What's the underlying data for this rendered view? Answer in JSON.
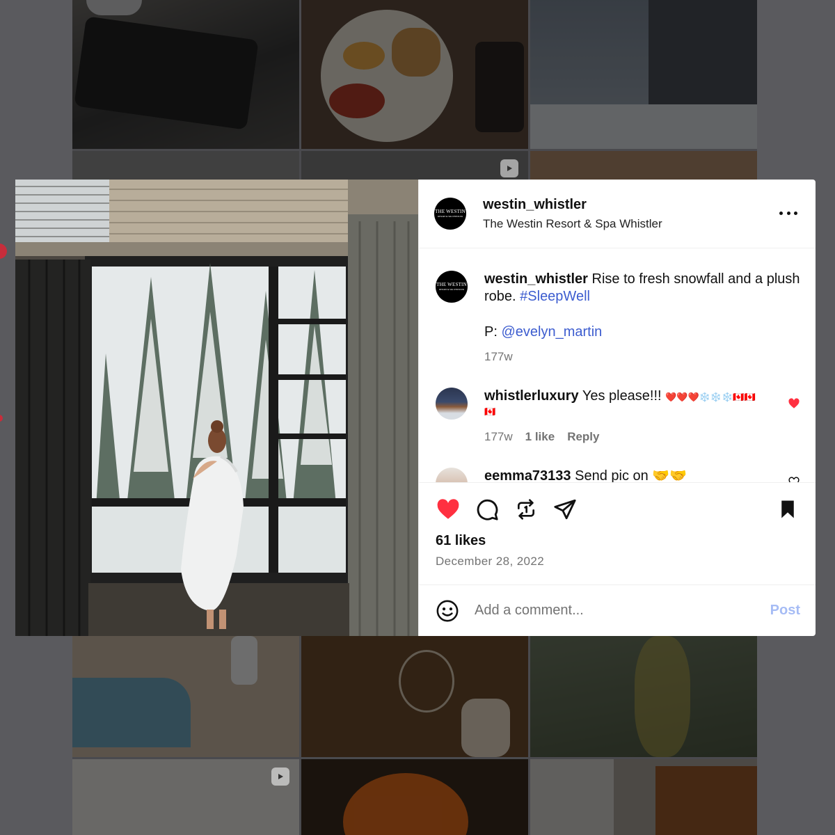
{
  "post": {
    "username": "westin_whistler",
    "location": "The Westin Resort & Spa Whistler",
    "avatar_logo_text": "THE WESTIN",
    "avatar_logo_sub": "RESORT & SPA WHISTLER",
    "caption": {
      "username": "westin_whistler",
      "text": "Rise to fresh snowfall and a plush robe.",
      "hashtag": "#SleepWell",
      "credit_prefix": "P:",
      "credit_handle": "@evelyn_martin",
      "time": "177w"
    },
    "likes": "61 likes",
    "date": "December 28, 2022",
    "liked": true,
    "saved": true
  },
  "comments": [
    {
      "username": "whistlerluxury",
      "text": "Yes please!!!",
      "emojis_line1": "❤️❤️❤️❄️❄️❄️🇨🇦🇨🇦",
      "emojis_line2": "🇨🇦",
      "time": "177w",
      "likes": "1 like",
      "reply": "Reply",
      "liked": true
    },
    {
      "username": "eemma73133",
      "text": "Send pic on",
      "emojis": "🤝🤝"
    }
  ],
  "add_comment": {
    "placeholder": "Add a comment...",
    "post_label": "Post"
  },
  "icons": {
    "more": "more-options-icon",
    "like": "heart-icon",
    "comment": "comment-icon",
    "repost": "repost-icon",
    "share": "share-icon",
    "save": "bookmark-icon",
    "emoji": "emoji-icon"
  },
  "colors": {
    "like_red": "#ff3040",
    "link_blue": "#3c5ccf",
    "post_disabled": "#a6bcf5",
    "muted_text": "#737373"
  }
}
